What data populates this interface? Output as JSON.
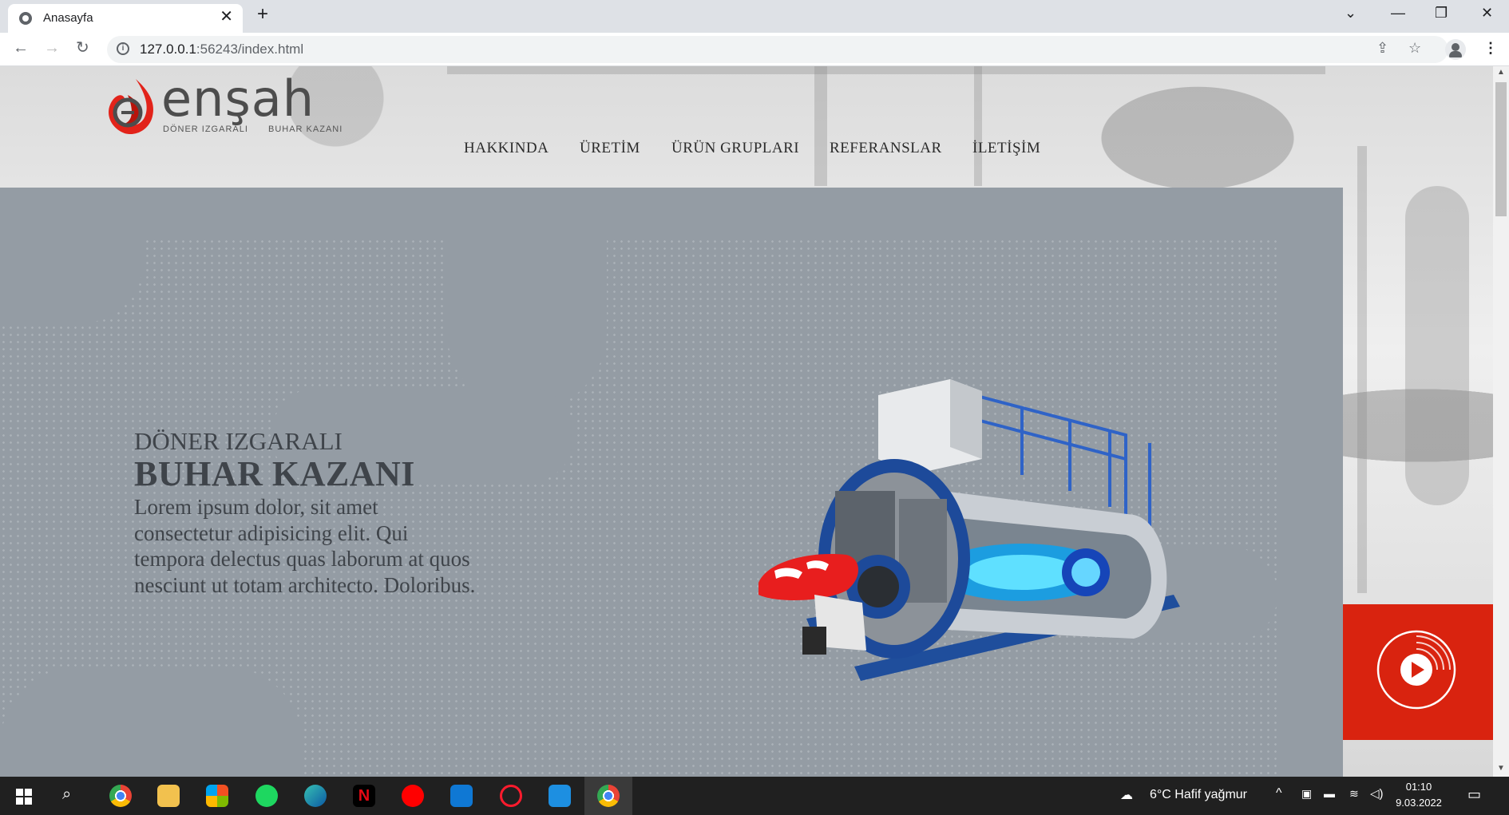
{
  "browser": {
    "tab_title": "Anasayfa",
    "tab_close": "✕",
    "new_tab": "+",
    "url_host": "127.0.0.1",
    "url_rest": ":56243/index.html"
  },
  "site": {
    "logo_text": "enşah",
    "logo_sub1": "DÖNER IZGARALI",
    "logo_sub2": "BUHAR KAZANI",
    "menu": [
      "HAKKINDA",
      "ÜRETİM",
      "ÜRÜN GRUPLARI",
      "REFERANSLAR",
      "İLETİŞİM"
    ],
    "slide": {
      "subtitle": "DÖNER IZGARALI",
      "title": "BUHAR KAZANI",
      "text": "Lorem ipsum dolor, sit amet consectetur adipisicing elit. Qui tempora delectus quas laborum at quos nesciunt ut totam architecto. Doloribus."
    }
  },
  "taskbar": {
    "weather": "6°C  Hafif yağmur",
    "time": "01:10",
    "date": "9.03.2022"
  },
  "colors": {
    "accent_red": "#d9230f",
    "slide_bg": "#949ca4",
    "text_dark": "#3f444a"
  }
}
